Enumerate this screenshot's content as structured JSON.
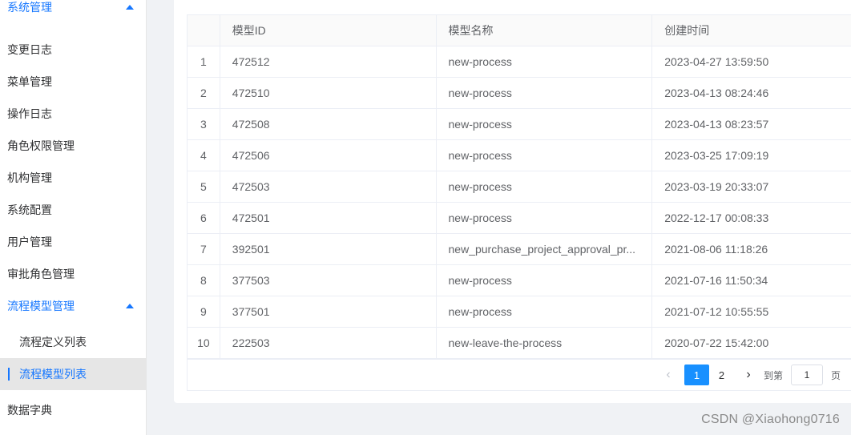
{
  "sidebar": {
    "items": [
      {
        "label": "系统管理",
        "type": "group",
        "expanded": true
      },
      {
        "label": "变更日志"
      },
      {
        "label": "菜单管理"
      },
      {
        "label": "操作日志"
      },
      {
        "label": "角色权限管理"
      },
      {
        "label": "机构管理"
      },
      {
        "label": "系统配置"
      },
      {
        "label": "用户管理"
      },
      {
        "label": "审批角色管理"
      },
      {
        "label": "流程模型管理",
        "type": "group",
        "expanded": true
      },
      {
        "label": "流程定义列表",
        "type": "sub"
      },
      {
        "label": "流程模型列表",
        "type": "sub",
        "active": true
      },
      {
        "label": "数据字典"
      }
    ]
  },
  "table": {
    "headers": [
      "",
      "模型ID",
      "模型名称",
      "创建时间"
    ],
    "rows": [
      {
        "idx": "1",
        "id": "472512",
        "name": "new-process",
        "created": "2023-04-27 13:59:50"
      },
      {
        "idx": "2",
        "id": "472510",
        "name": "new-process",
        "created": "2023-04-13 08:24:46"
      },
      {
        "idx": "3",
        "id": "472508",
        "name": "new-process",
        "created": "2023-04-13 08:23:57"
      },
      {
        "idx": "4",
        "id": "472506",
        "name": "new-process",
        "created": "2023-03-25 17:09:19"
      },
      {
        "idx": "5",
        "id": "472503",
        "name": "new-process",
        "created": "2023-03-19 20:33:07"
      },
      {
        "idx": "6",
        "id": "472501",
        "name": "new-process",
        "created": "2022-12-17 00:08:33"
      },
      {
        "idx": "7",
        "id": "392501",
        "name": "new_purchase_project_approval_pr...",
        "created": "2021-08-06 11:18:26"
      },
      {
        "idx": "8",
        "id": "377503",
        "name": "new-process",
        "created": "2021-07-16 11:50:34"
      },
      {
        "idx": "9",
        "id": "377501",
        "name": "new-process",
        "created": "2021-07-12 10:55:55"
      },
      {
        "idx": "10",
        "id": "222503",
        "name": "new-leave-the-process",
        "created": "2020-07-22 15:42:00"
      }
    ]
  },
  "pagination": {
    "prev_icon": "chevron-left-icon",
    "next_icon": "chevron-right-icon",
    "prev_glyph": "‹",
    "next_glyph": "›",
    "pages": [
      "1",
      "2"
    ],
    "current_page": "1",
    "goto_prefix": "到第",
    "goto_value": "1",
    "goto_suffix": "页"
  },
  "watermark": "CSDN @Xiaohong0716",
  "colors": {
    "accent": "#1677ff",
    "active_bg": "#e6e6e6",
    "page_active": "#1890ff"
  }
}
